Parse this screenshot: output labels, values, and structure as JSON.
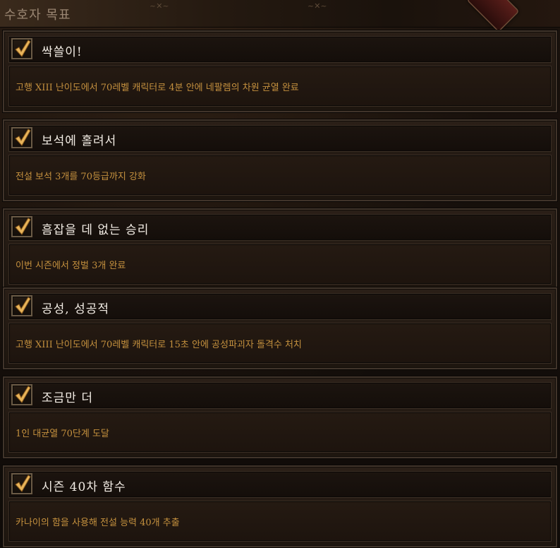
{
  "panel": {
    "title": "수호자 목표"
  },
  "achievements": [
    {
      "title": "싹쓸이!",
      "description": "고행 XIII 난이도에서 70레벨 캐릭터로 4분 안에 네팔렘의 차원 균열 완료",
      "completed": true
    },
    {
      "title": "보석에 홀려서",
      "description": "전설 보석 3개를 70등급까지 강화",
      "completed": true
    },
    {
      "title": "흠잡을 데 없는 승리",
      "description": "이번 시즌에서 정벌 3개 완료",
      "completed": true
    },
    {
      "title": "공성, 성공적",
      "description": "고행 XIII 난이도에서 70레벨 캐릭터로 15초 안에 공성파괴자 돌격수 처치",
      "completed": true
    },
    {
      "title": "조금만 더",
      "description": "1인 대균열 70단계 도달",
      "completed": true
    },
    {
      "title": "시즌 40차 함수",
      "description": "카나이의 함을 사용해 전설 능력 40개 추출",
      "completed": true
    }
  ],
  "colors": {
    "title_text": "#f2ece4",
    "description_text": "#c4903e",
    "checkmark": "#e8b45a"
  }
}
